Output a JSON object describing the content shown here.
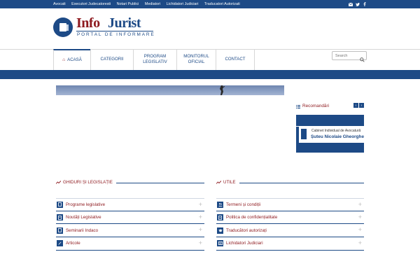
{
  "topbar": {
    "links": [
      "Avocati",
      "Executori Judecatoresti",
      "Notari Publici",
      "Mediatori",
      "Lichidatori Judiciari",
      "Traducatori Autorizati"
    ],
    "icons": [
      "email-icon",
      "twitter-icon",
      "facebook-icon"
    ]
  },
  "logo": {
    "info": "Info",
    "jurist": "Jurist",
    "subtitle": "PORTAL DE INFORMARE"
  },
  "nav": {
    "items": [
      {
        "label": "ACASĂ",
        "active": true,
        "icon": "home-icon"
      },
      {
        "label": "CATEGORII"
      },
      {
        "label1": "PROGRAM",
        "label2": "LEGISLATIV"
      },
      {
        "label1": "MONITORUL",
        "label2": "OFICIAL"
      },
      {
        "label": "CONTACT"
      }
    ],
    "search_placeholder": "Search"
  },
  "sidebar": {
    "title": "Recomandări",
    "card_line1": "Cabinet Individual de Avocatură",
    "card_line2": "Șuteu Nicolaie Gheorghe"
  },
  "sections": {
    "left": {
      "title": "GHIDURI ȘI LEGISLAȚIE",
      "items": [
        "Programe legislative",
        "Noutăți Legislative",
        "Seminarii Indaco",
        "Articole"
      ]
    },
    "right": {
      "title": "UTILE",
      "items": [
        "Termeni și condiții",
        "Politica de confidențialitate",
        "Traducători autorizați",
        "Lichidatori Judiciari"
      ]
    }
  },
  "colors": {
    "brand_blue": "#1d4a86",
    "brand_red": "#8e1a1f"
  }
}
